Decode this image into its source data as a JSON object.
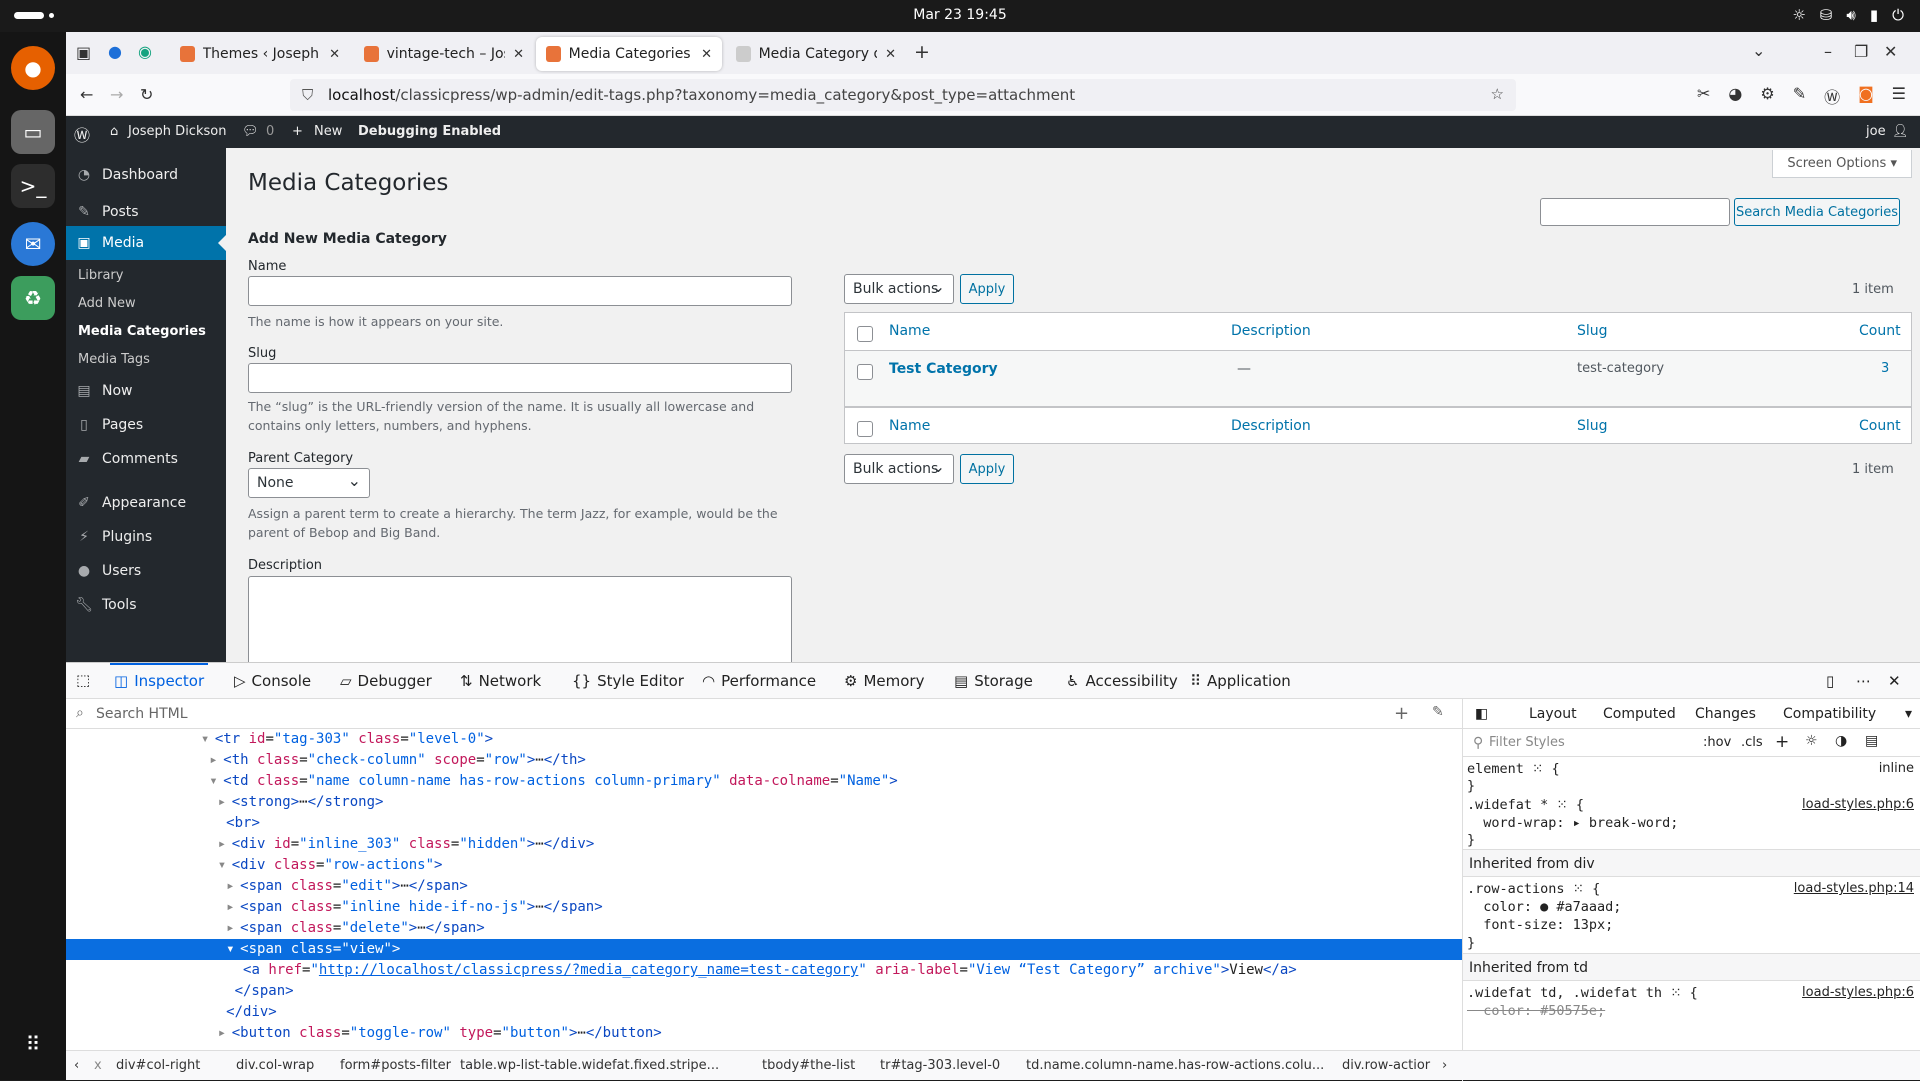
{
  "system": {
    "clock": "Mar 23  19:45"
  },
  "browser": {
    "tabs": [
      {
        "title": "Themes ‹ Joseph Dickson",
        "color": "#e8733a"
      },
      {
        "title": "vintage-tech – Joseph Dic",
        "color": "#e8733a"
      },
      {
        "title": "Media Categories ‹ Joseph",
        "color": "#e8733a"
      },
      {
        "title": "Media Category doesn't c",
        "color": "#cccccc"
      }
    ],
    "url_host": "localhost",
    "url_path": "/classicpress/wp-admin/edit-tags.php?taxonomy=media_category&post_type=attachment"
  },
  "wp_admin_bar": {
    "site": "Joseph Dickson",
    "comments": "0",
    "new": "New",
    "debug": "Debugging Enabled",
    "user": "joe"
  },
  "sidebar": {
    "items": [
      "Dashboard",
      "Posts",
      "Media",
      "Now",
      "Pages",
      "Comments",
      "Appearance",
      "Plugins",
      "Users",
      "Tools"
    ],
    "submenu": [
      "Library",
      "Add New",
      "Media Categories",
      "Media Tags"
    ]
  },
  "page": {
    "title": "Media Categories",
    "screen_options": "Screen Options",
    "search_button": "Search Media Categories",
    "form": {
      "heading": "Add New Media Category",
      "name_label": "Name",
      "name_help": "The name is how it appears on your site.",
      "slug_label": "Slug",
      "slug_help": "The “slug” is the URL-friendly version of the name. It is usually all lowercase and contains only letters, numbers, and hyphens.",
      "parent_label": "Parent Category",
      "parent_value": "None",
      "parent_help": "Assign a parent term to create a hierarchy. The term Jazz, for example, would be the parent of Bebop and Big Band.",
      "desc_label": "Description"
    },
    "bulk": {
      "select": "Bulk actions",
      "apply": "Apply",
      "count": "1 item"
    },
    "table": {
      "headers": [
        "Name",
        "Description",
        "Slug",
        "Count"
      ],
      "rows": [
        {
          "name": "Test Category",
          "description": "—",
          "slug": "test-category",
          "count": "3"
        }
      ]
    }
  },
  "devtools": {
    "tabs": [
      "Inspector",
      "Console",
      "Debugger",
      "Network",
      "Style Editor",
      "Performance",
      "Memory",
      "Storage",
      "Accessibility",
      "Application"
    ],
    "search_placeholder": "Search HTML",
    "rule_tabs": [
      "Layout",
      "Computed",
      "Changes",
      "Compatibility"
    ],
    "filter_placeholder": "Filter Styles",
    "hov": ":hov",
    "cls": ".cls",
    "rules": {
      "element": "element ⁙ {",
      "element_src": "inline",
      "widefat_sel": ".widefat * ⁙ {",
      "widefat_prop": "  word-wrap: ▸ break-word;",
      "widefat_src": "load-styles.php:6",
      "inh_div": "Inherited from div",
      "rowact_sel": ".row-actions ⁙ {",
      "rowact_color": "  color: ● #a7aaad;",
      "rowact_font": "  font-size: 13px;",
      "rowact_src": "load-styles.php:14",
      "inh_td": "Inherited from td",
      "td_sel": ".widefat td, .widefat th ⁙ {",
      "td_prop": "  color: #50575e;",
      "td_src": "load-styles.php:6"
    },
    "crumbs": [
      "div#col-right",
      "div.col-wrap",
      "form#posts-filter",
      "table.wp-list-table.widefat.fixed.stripe...",
      "tbody#the-list",
      "tr#tag-303.level-0",
      "td.name.column-name.has-row-actions.colu...",
      "div.row-actior"
    ]
  }
}
